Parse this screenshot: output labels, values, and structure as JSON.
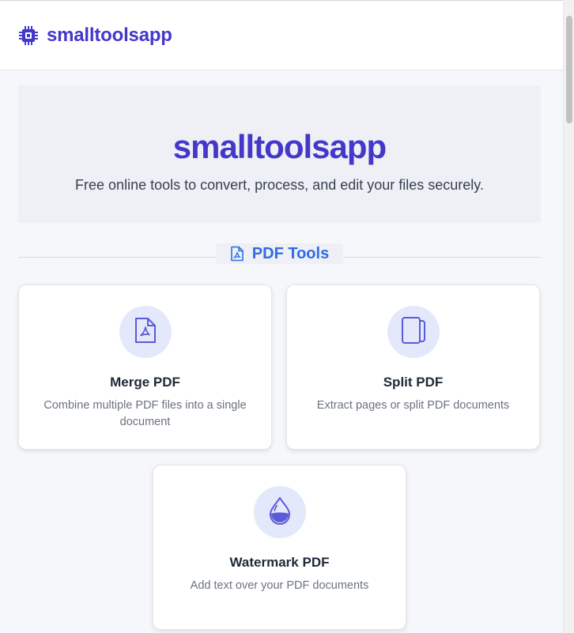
{
  "header": {
    "brand": "smalltoolsapp",
    "logo_icon": "chip-icon"
  },
  "hero": {
    "title": "smalltoolsapp",
    "subtitle": "Free online tools to convert, process, and edit your files securely."
  },
  "section": {
    "title": "PDF Tools",
    "icon": "pdf-file-icon"
  },
  "tools": [
    {
      "title": "Merge PDF",
      "description": "Combine multiple PDF files into a single document",
      "icon": "pdf-file-icon"
    },
    {
      "title": "Split PDF",
      "description": "Extract pages or split PDF documents",
      "icon": "copy-pages-icon"
    },
    {
      "title": "Watermark PDF",
      "description": "Add text over your PDF documents",
      "icon": "water-drop-icon"
    }
  ],
  "colors": {
    "brand": "#4338ca",
    "section_accent": "#2f6be6",
    "icon_accent": "#5b5bd6",
    "icon_bg": "#e4e8fb"
  }
}
